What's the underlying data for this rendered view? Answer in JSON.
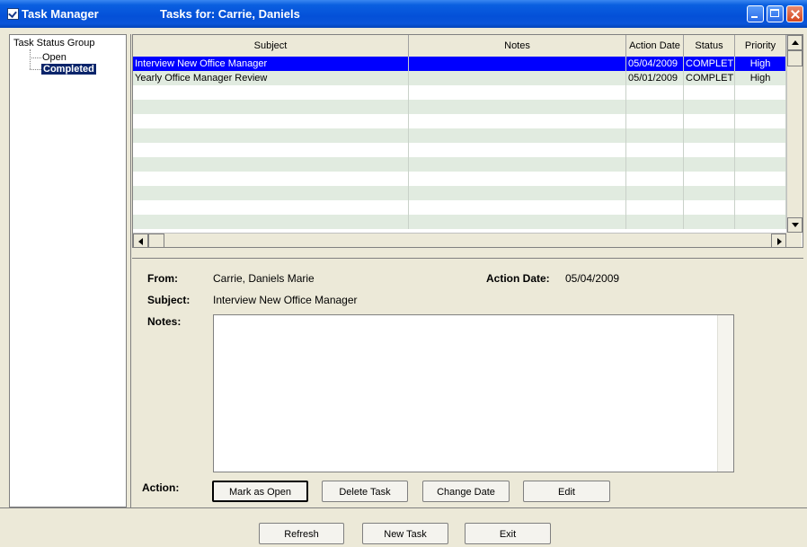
{
  "window": {
    "app_title": "Task Manager",
    "tasks_for": "Tasks for: Carrie, Daniels"
  },
  "tree": {
    "root": "Task Status Group",
    "items": [
      {
        "label": "Open",
        "selected": false
      },
      {
        "label": "Completed",
        "selected": true
      }
    ]
  },
  "grid": {
    "columns": [
      "Subject",
      "Notes",
      "Action Date",
      "Status",
      "Priority"
    ],
    "rows": [
      {
        "subject": "Interview New Office Manager",
        "notes": "",
        "action_date": "05/04/2009",
        "status": "COMPLETE",
        "priority": "High",
        "selected": true
      },
      {
        "subject": "Yearly Office Manager Review",
        "notes": "",
        "action_date": "05/01/2009",
        "status": "COMPLETE",
        "priority": "High",
        "selected": false
      }
    ]
  },
  "detail": {
    "from_label": "From:",
    "from_value": "Carrie, Daniels Marie",
    "action_date_label": "Action Date:",
    "action_date_value": "05/04/2009",
    "subject_label": "Subject:",
    "subject_value": "Interview New Office Manager",
    "notes_label": "Notes:",
    "notes_value": "",
    "action_label": "Action:"
  },
  "actions": {
    "mark_open": "Mark as Open",
    "delete": "Delete Task",
    "change_date": "Change Date",
    "edit": "Edit"
  },
  "footer": {
    "refresh": "Refresh",
    "new_task": "New Task",
    "exit": "Exit"
  },
  "colors": {
    "titlebar": "#0450d8",
    "selection": "#0000ff",
    "alt_row": "#e1ebe0",
    "dialog_bg": "#ece9d8"
  }
}
